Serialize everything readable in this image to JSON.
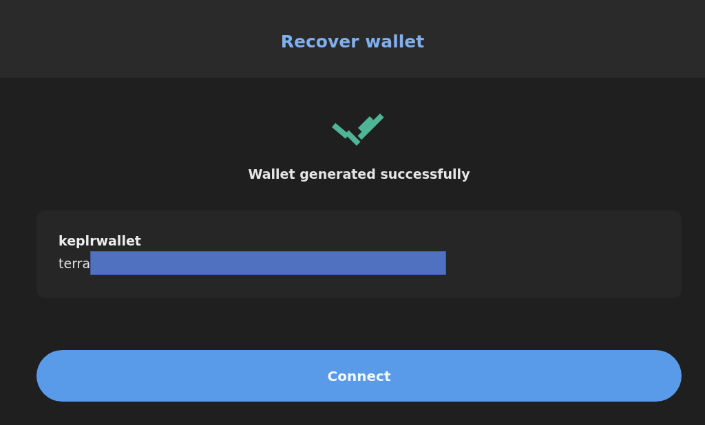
{
  "header": {
    "title": "Recover wallet"
  },
  "status": {
    "message": "Wallet generated successfully"
  },
  "wallet": {
    "name": "keplrwallet",
    "address": "terra"
  },
  "buttons": [
    {
      "label": "Connect"
    }
  ]
}
